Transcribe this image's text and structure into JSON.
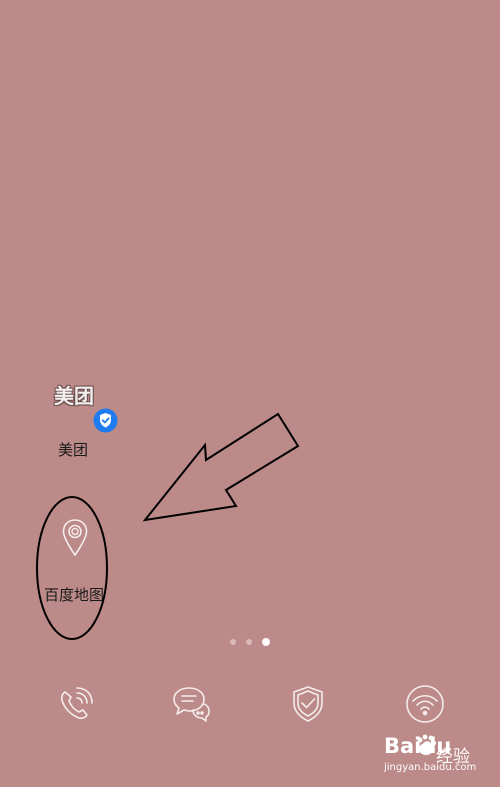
{
  "apps": {
    "meituan": {
      "logo_text": "美团",
      "label": "美团",
      "badge_icon": "verified-shield-icon",
      "badge_color": "#1e7bf2"
    },
    "baidu_map": {
      "label": "百度地图",
      "icon": "map-pin-icon"
    }
  },
  "page_indicator": {
    "total": 3,
    "active_index": 2
  },
  "dock": [
    {
      "icon": "phone-icon"
    },
    {
      "icon": "messages-icon"
    },
    {
      "icon": "security-shield-icon"
    },
    {
      "icon": "wifi-icon"
    }
  ],
  "watermark": {
    "brand": "Baidu",
    "product": "经验",
    "url": "jingyan.baidu.com"
  },
  "colors": {
    "wallpaper": "#bc8a88",
    "annotation_stroke": "#000000",
    "icon_line": "#f5ecec"
  }
}
